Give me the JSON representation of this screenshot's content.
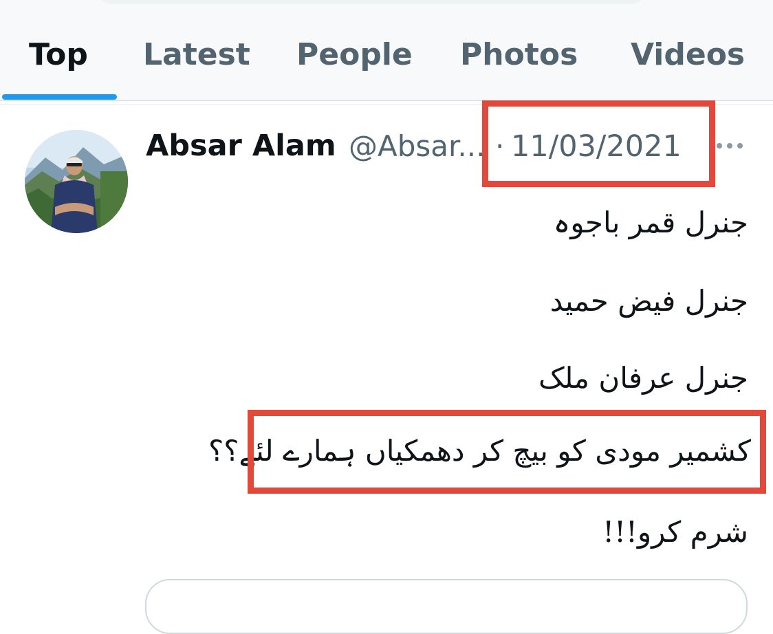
{
  "tabs": [
    {
      "label": "Top",
      "active": true
    },
    {
      "label": "Latest",
      "active": false
    },
    {
      "label": "People",
      "active": false
    },
    {
      "label": "Photos",
      "active": false
    },
    {
      "label": "Videos",
      "active": false
    }
  ],
  "tweet": {
    "display_name": "Absar Alam",
    "handle": "@Absar...",
    "separator": "·",
    "timestamp": "11/03/2021",
    "lines": [
      "جنرل قمر باجوہ",
      "جنرل فیض حمید",
      "جنرل عرفان ملک",
      "کشمیر مودی کو بیچ کر دھمکیاں ہمارے لئے؟؟",
      "شرم کرو!!!"
    ]
  },
  "colors": {
    "accent": "#1d9bf0",
    "text_primary": "#0f1419",
    "text_secondary": "#536471",
    "highlight": "#e2493b"
  },
  "icons": {
    "more": "more-horizontal-icon",
    "avatar": "profile-photo"
  }
}
